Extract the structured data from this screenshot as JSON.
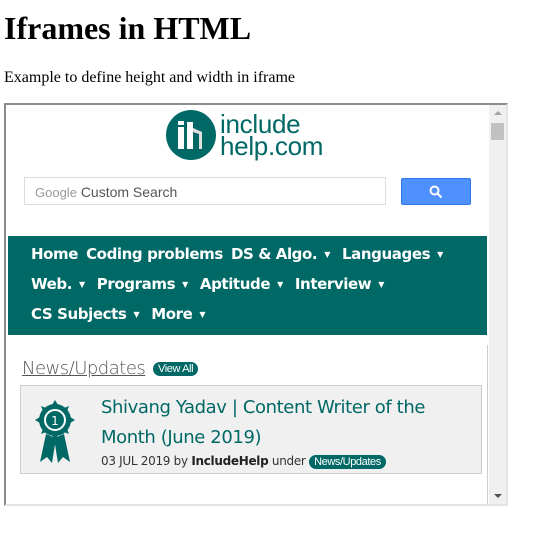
{
  "page": {
    "heading": "Iframes in HTML",
    "intro": "Example to define height and width in iframe"
  },
  "iframe": {
    "logo": {
      "line1": "include",
      "line2": "help.com",
      "color": "#006865"
    },
    "search": {
      "google_label": "Google",
      "placeholder": "Custom Search",
      "button_icon": "search-icon",
      "button_color": "#4d90fe"
    },
    "nav": {
      "background": "#006865",
      "rows": [
        [
          {
            "label": "Home",
            "dropdown": false
          },
          {
            "label": "Coding problems",
            "dropdown": false
          },
          {
            "label": "DS & Algo.",
            "dropdown": true
          },
          {
            "label": "Languages",
            "dropdown": true
          }
        ],
        [
          {
            "label": "Web.",
            "dropdown": true
          },
          {
            "label": "Programs",
            "dropdown": true
          },
          {
            "label": "Aptitude",
            "dropdown": true
          },
          {
            "label": "Interview",
            "dropdown": true
          }
        ],
        [
          {
            "label": "CS Subjects",
            "dropdown": true
          },
          {
            "label": "More",
            "dropdown": true
          }
        ]
      ],
      "caret": "▼"
    },
    "news": {
      "section_title": "News/Updates",
      "view_all": "View All",
      "item": {
        "icon": "award-ribbon-icon",
        "headline": "Shivang Yadav | Content Writer of the Month (June 2019)",
        "date": "03 JUL 2019",
        "by_label": "by",
        "author": "IncludeHelp",
        "under_label": "under",
        "category": "News/Updates"
      }
    }
  }
}
